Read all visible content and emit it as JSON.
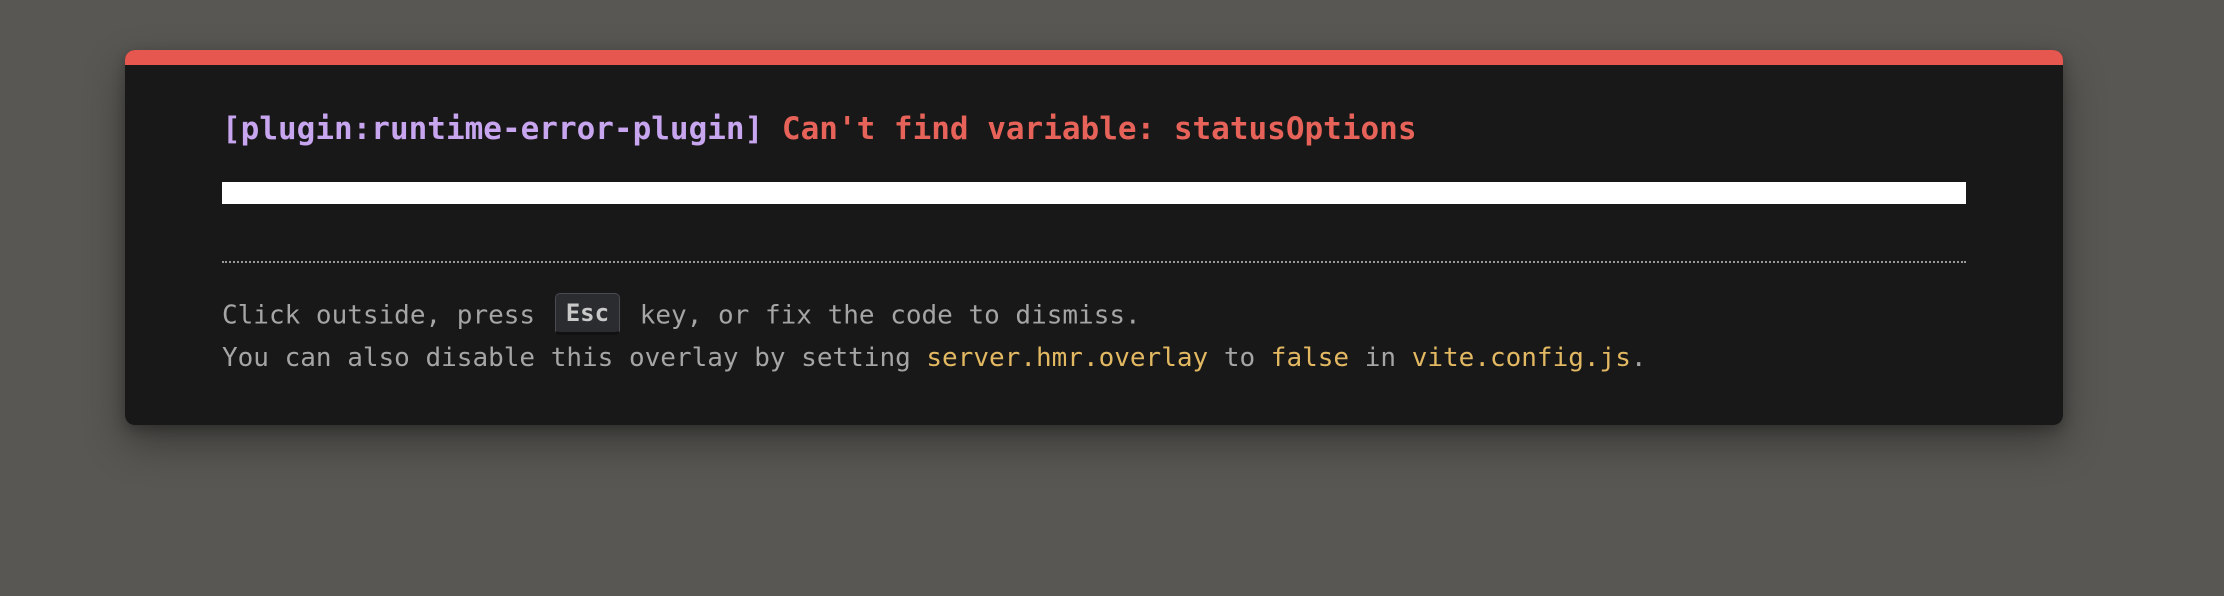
{
  "overlay": {
    "plugin": "[plugin:runtime-error-plugin]",
    "message": "Can't find variable: statusOptions",
    "stack_frame": "",
    "tip": {
      "line1_before": "Click outside, press ",
      "key": "Esc",
      "line1_after": " key, or fix the code to dismiss.",
      "line2_prefix": "You can also disable this overlay by setting ",
      "setting": "server.hmr.overlay",
      "to": " to ",
      "value": "false",
      "in": " in ",
      "file": "vite.config.js",
      "period": "."
    }
  },
  "colors": {
    "background": "#585753",
    "window": "#181818",
    "accent": "#e5574f",
    "plugin": "#c7a5ef",
    "error": "#e76258",
    "code": "#e2b862",
    "tip_text": "#a5a5a5"
  }
}
